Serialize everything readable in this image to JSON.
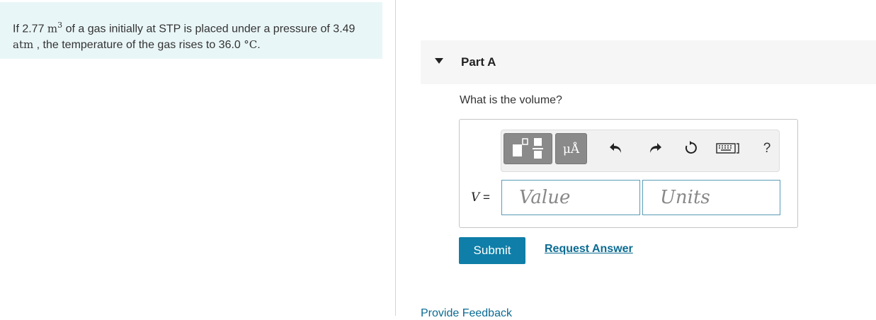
{
  "problem": {
    "text_before": "If 2.77 ",
    "volume_unit": "m",
    "volume_unit_exp": "3",
    "text_middle": " of a gas initially at STP is placed under a pressure of 3.49 ",
    "pressure_unit": "atm",
    "text_after": " , the temperature of the gas rises to 36.0 ",
    "temp_unit": "°C",
    "text_end": "."
  },
  "part": {
    "title": "Part A",
    "question": "What is the volume?"
  },
  "toolbar": {
    "units_label": "μÅ",
    "icons": [
      "templates-icon",
      "units-icon",
      "undo-icon",
      "redo-icon",
      "reset-icon",
      "keyboard-icon",
      "help-icon"
    ],
    "help_label": "?"
  },
  "answer": {
    "variable": "V",
    "equals": "=",
    "value_placeholder": "Value",
    "units_placeholder": "Units"
  },
  "actions": {
    "submit_label": "Submit",
    "request_label": "Request Answer"
  },
  "footer": {
    "feedback_label": "Provide Feedback"
  },
  "colors": {
    "problem_bg": "#e9f6f7",
    "accent": "#0f7ea8",
    "link": "#0b6b92"
  }
}
